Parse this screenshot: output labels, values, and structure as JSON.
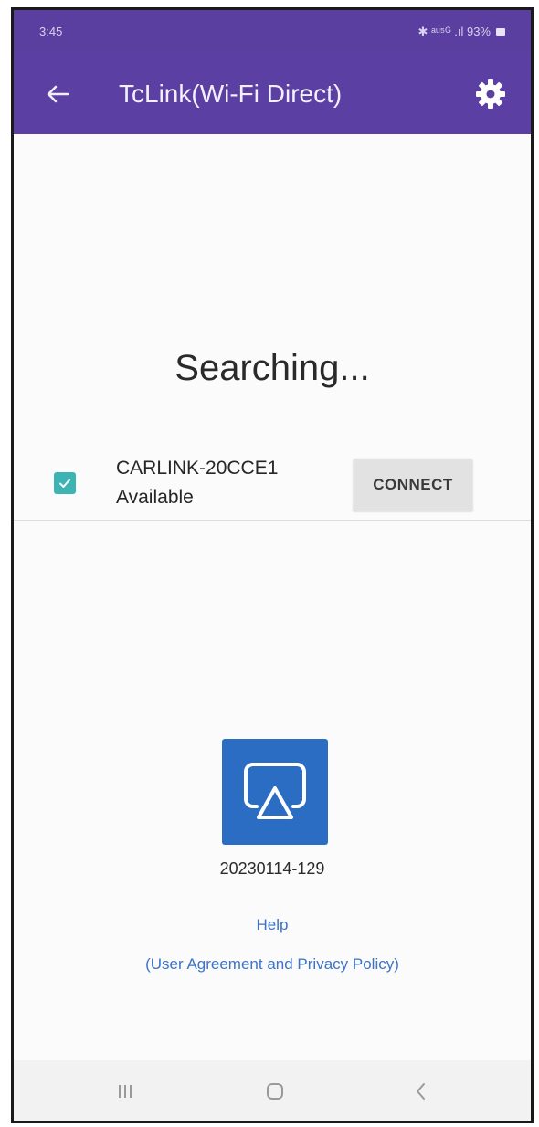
{
  "status_bar": {
    "time": "3:45",
    "indicators": "✱ ᵃᵘ⁵ᴳ .ıl 93%",
    "battery_icon": "battery-icon"
  },
  "app_bar": {
    "back_icon": "arrow-left-icon",
    "title": "TcLink(Wi-Fi Direct)",
    "settings_icon": "gear-icon",
    "background_color": "#5c3fa3"
  },
  "main": {
    "status_text": "Searching...",
    "device": {
      "name": "CARLINK-20CCE1",
      "status": "Available",
      "checked": true,
      "connect_label": "CONNECT"
    },
    "app_icon": "screen-cast-icon",
    "version": "20230114-129",
    "help_label": "Help",
    "policy_label": "(User Agreement and Privacy Policy)"
  },
  "nav_bar": {
    "recent_icon": "recent-apps-icon",
    "home_icon": "home-icon",
    "back_icon": "chevron-left-icon"
  }
}
